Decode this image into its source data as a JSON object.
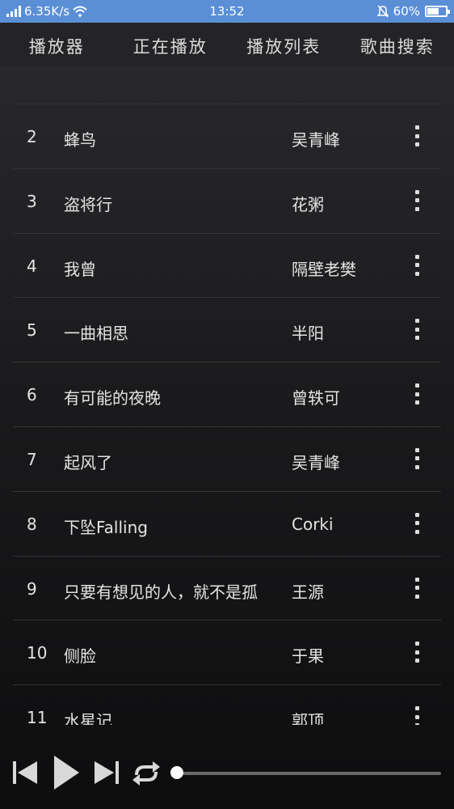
{
  "status_bar": {
    "net_speed": "6.35K/s",
    "time": "13:52",
    "battery": "60%",
    "icons": [
      "signal-icon",
      "wifi-icon",
      "bell-off-icon",
      "battery-icon"
    ]
  },
  "tabs": [
    {
      "label": "播放器"
    },
    {
      "label": "正在播放"
    },
    {
      "label": "播放列表"
    },
    {
      "label": "歌曲搜索"
    }
  ],
  "songs": [
    {
      "num": "2",
      "title": "蜂鸟",
      "artist": "吴青峰"
    },
    {
      "num": "3",
      "title": "盗将行",
      "artist": "花粥"
    },
    {
      "num": "4",
      "title": "我曾",
      "artist": "隔壁老樊"
    },
    {
      "num": "5",
      "title": "一曲相思",
      "artist": "半阳"
    },
    {
      "num": "6",
      "title": "有可能的夜晚",
      "artist": "曾轶可"
    },
    {
      "num": "7",
      "title": "起风了",
      "artist": "吴青峰"
    },
    {
      "num": "8",
      "title": "下坠Falling",
      "artist": "Corki"
    },
    {
      "num": "9",
      "title": "只要有想见的人，就不是孤",
      "artist": "王源"
    },
    {
      "num": "10",
      "title": "侧脸",
      "artist": "于果"
    },
    {
      "num": "11",
      "title": "水星记",
      "artist": "郭顶"
    }
  ],
  "player": {
    "progress": 0,
    "icons": [
      "previous-icon",
      "play-icon",
      "next-icon",
      "repeat-icon"
    ]
  },
  "colors": {
    "status_bar": "#5a8fd6",
    "background": "#1c1c1e",
    "tab_bar": "#242427",
    "text": "#e4e4e4",
    "divider": "#333333"
  }
}
